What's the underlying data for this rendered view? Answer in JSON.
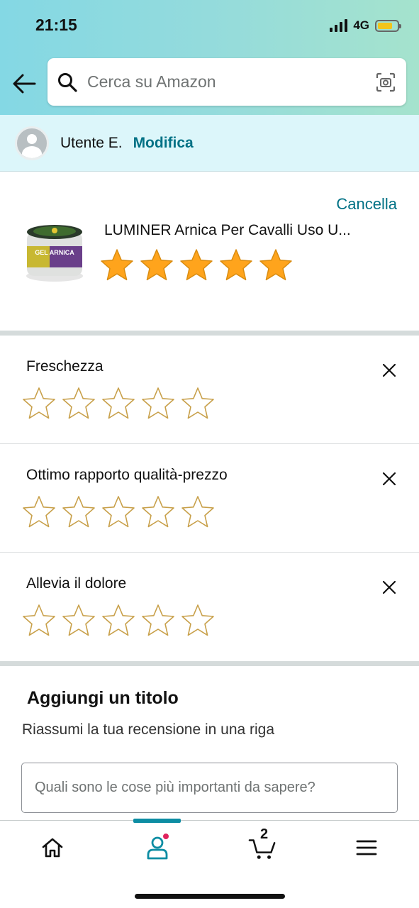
{
  "status_bar": {
    "time": "21:15",
    "network": "4G"
  },
  "search": {
    "placeholder": "Cerca su Amazon"
  },
  "user": {
    "name": "Utente E.",
    "edit_label": "Modifica"
  },
  "product": {
    "cancel_label": "Cancella",
    "title": "LUMINER Arnica Per Cavalli Uso U...",
    "image_alt": "GEL ARNICA",
    "rating": 5,
    "rating_max": 5
  },
  "attributes": [
    {
      "label": "Freschezza",
      "rating": 0
    },
    {
      "label": "Ottimo rapporto qualità-prezzo",
      "rating": 0
    },
    {
      "label": "Allevia il dolore",
      "rating": 0
    }
  ],
  "title_section": {
    "heading": "Aggiungi un titolo",
    "subheading": "Riassumi la tua recensione in una riga",
    "input_placeholder": "Quali sono le cose più importanti da sapere?"
  },
  "bottom_nav": {
    "cart_count": "2",
    "items": [
      {
        "icon": "home-icon"
      },
      {
        "icon": "account-icon",
        "active": true
      },
      {
        "icon": "cart-icon"
      },
      {
        "icon": "menu-icon"
      }
    ]
  },
  "colors": {
    "header_gradient_start": "#84d8e4",
    "header_gradient_end": "#a5e3cd",
    "link": "#007185",
    "star_fill": "#ffa41c",
    "star_outline": "#c8a04a",
    "active_tab": "#0d8da3"
  }
}
